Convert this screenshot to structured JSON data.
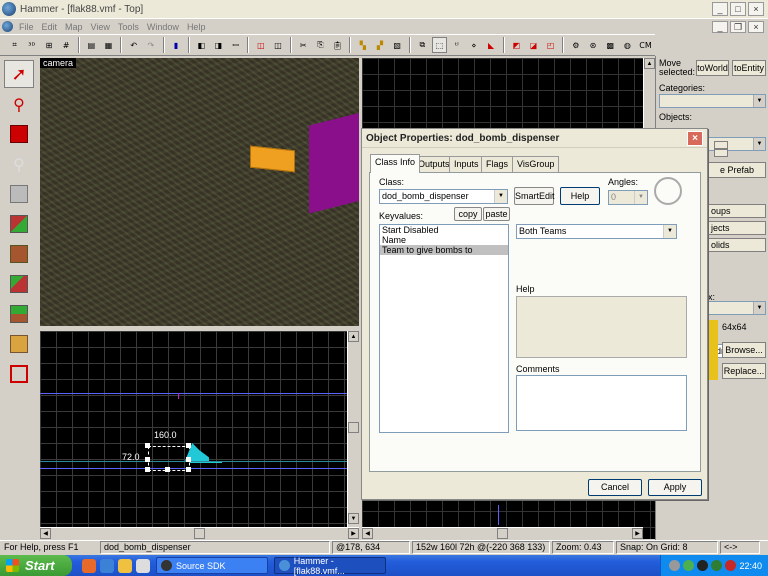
{
  "window": {
    "title": "Hammer - [flak88.vmf - Top]"
  },
  "menu": [
    "File",
    "Edit",
    "Map",
    "View",
    "Tools",
    "Window",
    "Help"
  ],
  "toolbar": {
    "cm_label": "CM"
  },
  "viewport3d": {
    "label": "camera"
  },
  "viewportTop": {
    "dim_width": "160.0",
    "dim_height": "72.0"
  },
  "rightpanel": {
    "move_label": "Move selected:",
    "toworld": "toWorld",
    "toentity": "toEntity",
    "categories_label": "Categories:",
    "objects_label": "Objects:",
    "prefab_btn": "e Prefab",
    "groups_btn": "oups",
    "objects_btn": "jects",
    "solids_btn": "olids",
    "x_label": "x:",
    "texture_value": "odraw",
    "size_label": "64x64",
    "browse_btn": "Browse...",
    "replace_btn": "Replace..."
  },
  "dialog": {
    "title": "Object Properties: dod_bomb_dispenser",
    "tabs": [
      "Class Info",
      "Outputs",
      "Inputs",
      "Flags",
      "VisGroup"
    ],
    "class_label": "Class:",
    "class_value": "dod_bomb_dispenser",
    "smartedit": "SmartEdit",
    "help_btn": "Help",
    "angles_label": "Angles:",
    "angles_value": "0",
    "keyvalues_label": "Keyvalues:",
    "copy_btn": "copy",
    "paste_btn": "paste",
    "keyvalues": [
      "Start Disabled",
      "Name",
      "Team to give bombs to"
    ],
    "selected_index": 2,
    "value_combo": "Both Teams",
    "help_label": "Help",
    "comments_label": "Comments",
    "cancel": "Cancel",
    "apply": "Apply"
  },
  "statusbar": {
    "help": "For Help, press F1",
    "selection": "dod_bomb_dispenser",
    "coords": "@178, 634",
    "size": "152w 160l 72h @(-220 368 133)",
    "zoom": "Zoom: 0.43",
    "snap": "Snap: On Grid: 8",
    "extra": "<->"
  },
  "taskbar": {
    "start": "Start",
    "tasks": [
      "Source SDK",
      "Hammer - [flak88.vmf..."
    ],
    "clock": "22:40"
  }
}
